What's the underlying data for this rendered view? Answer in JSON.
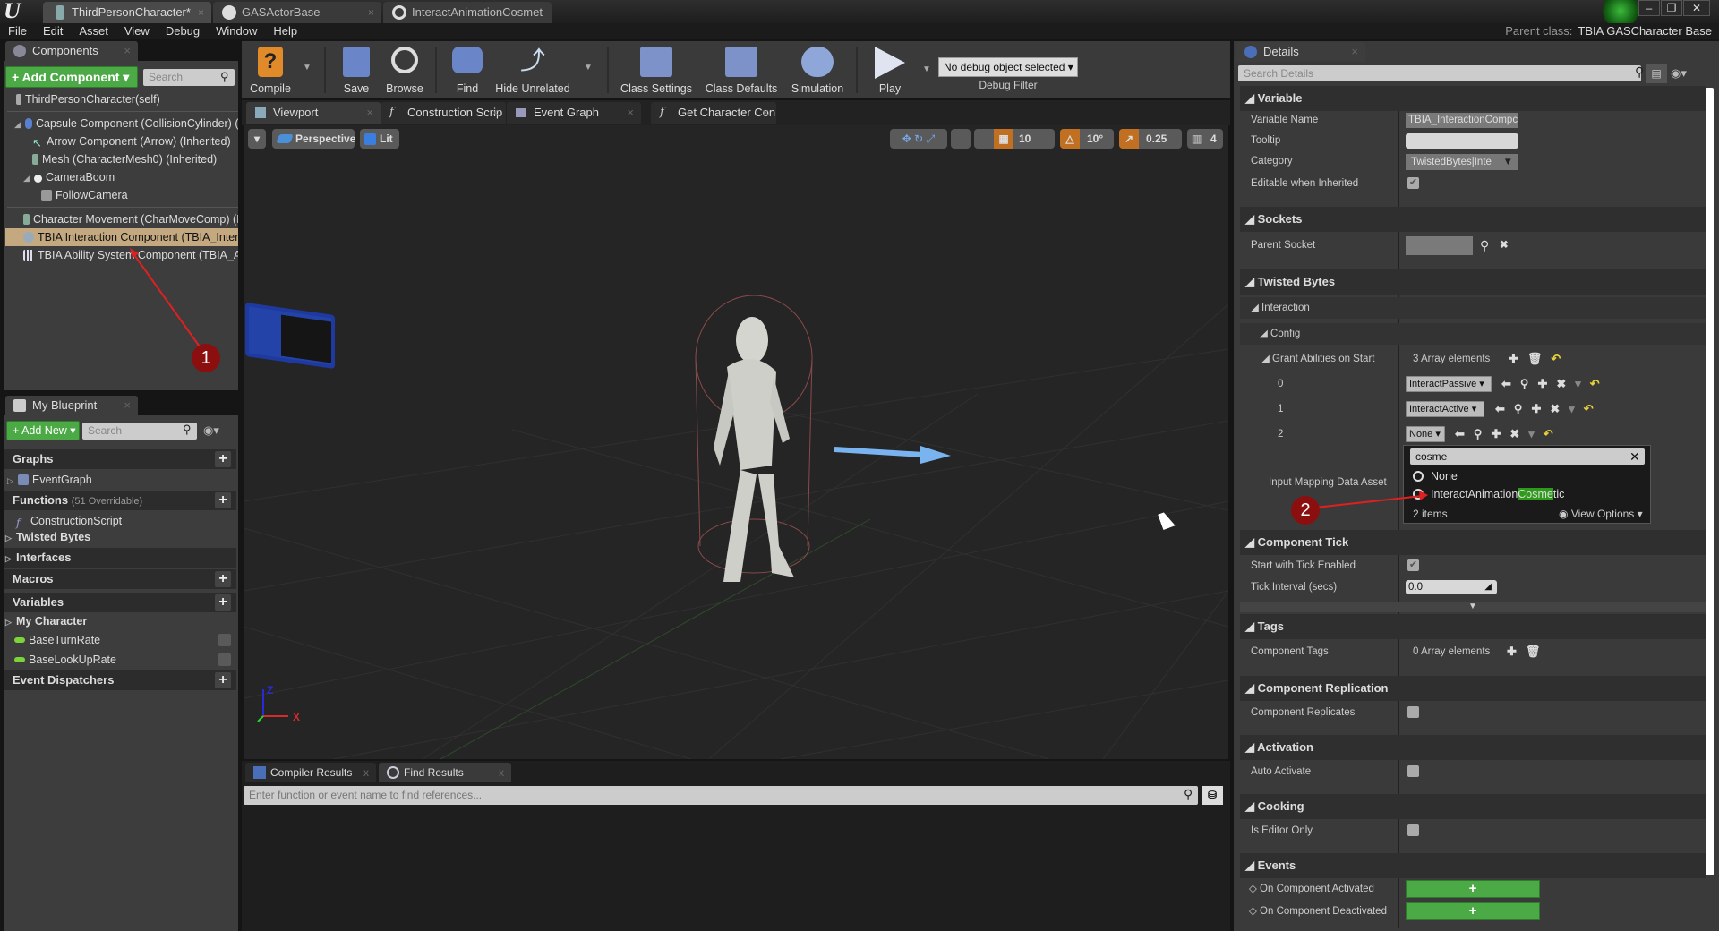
{
  "titlebar": {
    "tabs": [
      {
        "label": "ThirdPersonCharacter*",
        "active": true
      },
      {
        "label": "GASActorBase",
        "active": false
      },
      {
        "label": "InteractAnimationCosmet",
        "active": false
      }
    ],
    "close_glyph": "×"
  },
  "menubar": {
    "items": [
      "File",
      "Edit",
      "Asset",
      "View",
      "Debug",
      "Window",
      "Help"
    ],
    "parent_class_label": "Parent class:",
    "parent_class_value": "TBIA GASCharacter Base"
  },
  "components_panel": {
    "tab_label": "Components",
    "add_button": "+ Add Component ▾",
    "search_placeholder": "Search",
    "root": "ThirdPersonCharacter(self)",
    "items": [
      {
        "label": "Capsule Component (CollisionCylinder) (",
        "indent": 1,
        "icon": "capsule-icon"
      },
      {
        "label": "Arrow Component (Arrow) (Inherited)",
        "indent": 2,
        "icon": "arrow-icon"
      },
      {
        "label": "Mesh (CharacterMesh0) (Inherited)",
        "indent": 2,
        "icon": "mesh-icon"
      },
      {
        "label": "CameraBoom",
        "indent": 2,
        "icon": "camera-boom-icon"
      },
      {
        "label": "FollowCamera",
        "indent": 3,
        "icon": "camera-icon"
      },
      {
        "label": "Character Movement (CharMoveComp) (I",
        "indent": 0,
        "icon": "movement-icon"
      },
      {
        "label": "TBIA Interaction Component (TBIA_Intera",
        "indent": 0,
        "icon": "interaction-component-icon",
        "selected": true
      },
      {
        "label": "TBIA Ability System Component (TBIA_Al",
        "indent": 0,
        "icon": "ability-system-icon"
      }
    ],
    "annotation": "1"
  },
  "my_blueprint": {
    "tab_label": "My Blueprint",
    "add_button": "+ Add New ▾",
    "search_placeholder": "Search",
    "sections": {
      "graphs": "Graphs",
      "event_graph": "EventGraph",
      "functions": "Functions",
      "functions_count": "(51 Overridable)",
      "construction_script": "ConstructionScript",
      "twisted_bytes": "Twisted Bytes",
      "interfaces": "Interfaces",
      "macros": "Macros",
      "variables": "Variables",
      "my_character": "My Character",
      "var1": "BaseTurnRate",
      "var2": "BaseLookUpRate",
      "event_dispatchers": "Event Dispatchers"
    }
  },
  "toolbar": {
    "compile": "Compile",
    "save": "Save",
    "browse": "Browse",
    "find": "Find",
    "hide_unrelated": "Hide Unrelated",
    "class_settings": "Class Settings",
    "class_defaults": "Class Defaults",
    "simulation": "Simulation",
    "play": "Play",
    "debug_object": "No debug object selected ▾",
    "debug_filter": "Debug Filter"
  },
  "editor_tabs": [
    "Viewport",
    "Construction Scrip",
    "Event Graph",
    "Get Character Con"
  ],
  "viewport": {
    "perspective": "Perspective",
    "lit": "Lit",
    "grid_snap": "10",
    "rotation_snap": "10°",
    "scale_snap": "0.25",
    "camera_speed": "4",
    "axis_x": "X",
    "axis_z": "Z"
  },
  "bottom_panel": {
    "tabs": [
      "Compiler Results",
      "Find Results"
    ],
    "find_placeholder": "Enter function or event name to find references..."
  },
  "details": {
    "tab_label": "Details",
    "search_placeholder": "Search Details",
    "variable": {
      "header": "Variable",
      "variable_name_label": "Variable Name",
      "variable_name_value": "TBIA_InteractionCompc",
      "tooltip_label": "Tooltip",
      "tooltip_value": "",
      "category_label": "Category",
      "category_value": "TwistedBytes|Inte",
      "editable_label": "Editable when Inherited",
      "editable_checked": true
    },
    "sockets": {
      "header": "Sockets",
      "parent_socket_label": "Parent Socket"
    },
    "twisted_bytes": {
      "header": "Twisted Bytes",
      "interaction": "Interaction",
      "config": "Config",
      "grant_label": "Grant Abilities on Start",
      "grant_count": "3 Array elements",
      "elements": [
        {
          "index": "0",
          "value": "InteractPassive"
        },
        {
          "index": "1",
          "value": "InteractActive"
        },
        {
          "index": "2",
          "value": "None"
        }
      ],
      "input_mapping_label": "Input Mapping Data Asset"
    },
    "picker": {
      "search_value": "cosme",
      "options": [
        {
          "prefix": "None",
          "match": "",
          "suffix": ""
        },
        {
          "prefix": "InteractAnimation",
          "match": "Cosme",
          "suffix": "tic"
        }
      ],
      "count": "2 items",
      "view_options": "View Options ▾",
      "annotation": "2"
    },
    "component_tick": {
      "header": "Component Tick",
      "start_label": "Start with Tick Enabled",
      "start_checked": true,
      "interval_label": "Tick Interval (secs)",
      "interval_value": "0.0"
    },
    "tags": {
      "header": "Tags",
      "label": "Component Tags",
      "count": "0 Array elements"
    },
    "replication": {
      "header": "Component Replication",
      "label": "Component Replicates",
      "checked": false
    },
    "activation": {
      "header": "Activation",
      "label": "Auto Activate",
      "checked": false
    },
    "cooking": {
      "header": "Cooking",
      "label": "Is Editor Only",
      "checked": false
    },
    "events": {
      "header": "Events",
      "activated": "On Component Activated",
      "deactivated": "On Component Deactivated",
      "add_glyph": "+"
    }
  },
  "colors": {
    "accent_green": "#4caa46",
    "selection": "#c4a880",
    "annotation_red": "#8b0f0f",
    "match_highlight": "#2e9a1a"
  }
}
